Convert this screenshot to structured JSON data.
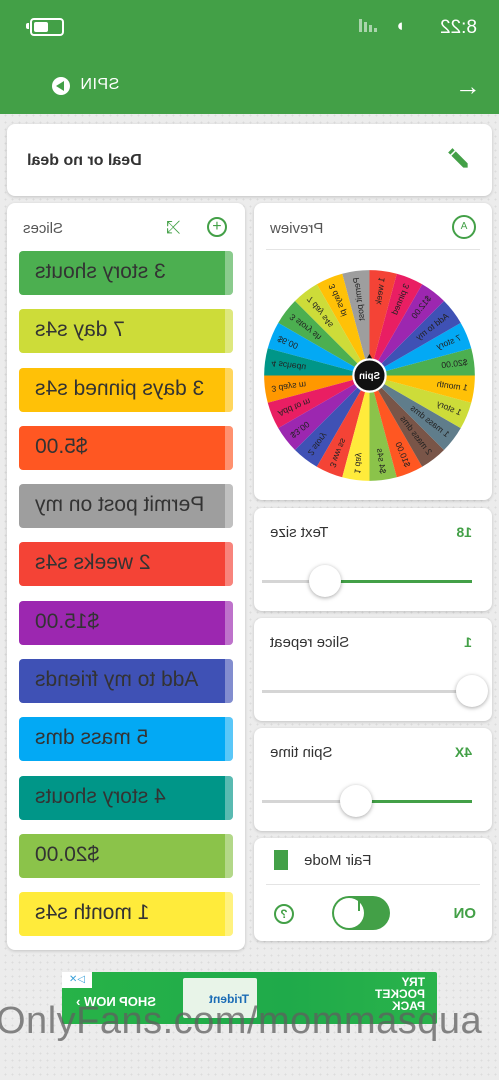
{
  "status_bar": {
    "time": "8:22",
    "battery_icon": "battery-icon",
    "wifi_icon": "wifi-icon",
    "signal_icon": "signal-icon"
  },
  "app_bar": {
    "title": "SPIN",
    "back_icon": "back-arrow-icon",
    "play_icon": "play-icon",
    "color": "#43a047"
  },
  "wheel_title": "Deal or no deal",
  "preview": {
    "label": "Preview",
    "center_label": "Spin"
  },
  "slices": {
    "label": "Slices",
    "items": [
      {
        "text": "3 story shouts",
        "color": "#4caf50"
      },
      {
        "text": "7 day s4s",
        "color": "#cddc39"
      },
      {
        "text": "3 days pinned s4s",
        "color": "#ffc107"
      },
      {
        "text": "$5.00",
        "color": "#ff5722"
      },
      {
        "text": "Permit post on my",
        "color": "#9e9e9e"
      },
      {
        "text": "2 weeks s4s",
        "color": "#f44336"
      },
      {
        "text": "$15.00",
        "color": "#9c27b0"
      },
      {
        "text": "Add to my friends",
        "color": "#3f51b5"
      },
      {
        "text": "5 mass dms",
        "color": "#03a9f4"
      },
      {
        "text": "4 story shouts",
        "color": "#009688"
      },
      {
        "text": "$20.00",
        "color": "#8bc34a"
      },
      {
        "text": "1 month s4s",
        "color": "#ffeb3b"
      }
    ]
  },
  "wheel_labels": [
    "Permit post",
    "3 days pi",
    "7 day s4s",
    "3 story sh",
    "$6.00",
    "4 schedu",
    "3 days m",
    "Add to m",
    "$3.00",
    "2 story",
    "3 ww ss",
    "1 day",
    "$4 s4s",
    "$10.00",
    "2 mass dms",
    "1 mass dms",
    "1 story",
    "1 month",
    "$20.00",
    "7 story",
    "Add to my",
    "$12.00",
    "3 pinned",
    "1 week"
  ],
  "wheel_colors": [
    "#9e9e9e",
    "#ffc107",
    "#cddc39",
    "#4caf50",
    "#03a9f4",
    "#009688",
    "#ff9800",
    "#e91e63",
    "#9c27b0",
    "#3f51b5",
    "#f44336",
    "#ffeb3b",
    "#8bc34a",
    "#ff5722",
    "#795548",
    "#607d8b",
    "#cddc39",
    "#ffc107",
    "#4caf50",
    "#03a9f4",
    "#3f51b5",
    "#9c27b0",
    "#e91e63",
    "#f44336"
  ],
  "settings": {
    "text_size": {
      "label": "Text size",
      "value": "18",
      "level": 0.7
    },
    "slice_repeat": {
      "label": "Slice repeat",
      "value": "1",
      "level": 0.0
    },
    "spin_time": {
      "label": "Spin time",
      "value": "4X",
      "level": 0.55
    },
    "fair_mode": {
      "label": "Fair Mode",
      "state": "ON",
      "enabled": true
    }
  },
  "ad": {
    "line1": "TRY",
    "line2": "POCKET",
    "line3": "PACK",
    "brand": "Trident",
    "cta": "SHOP NOW ›",
    "choice": "▷✕"
  },
  "watermark": "OnlyFans.com/mommasqua"
}
